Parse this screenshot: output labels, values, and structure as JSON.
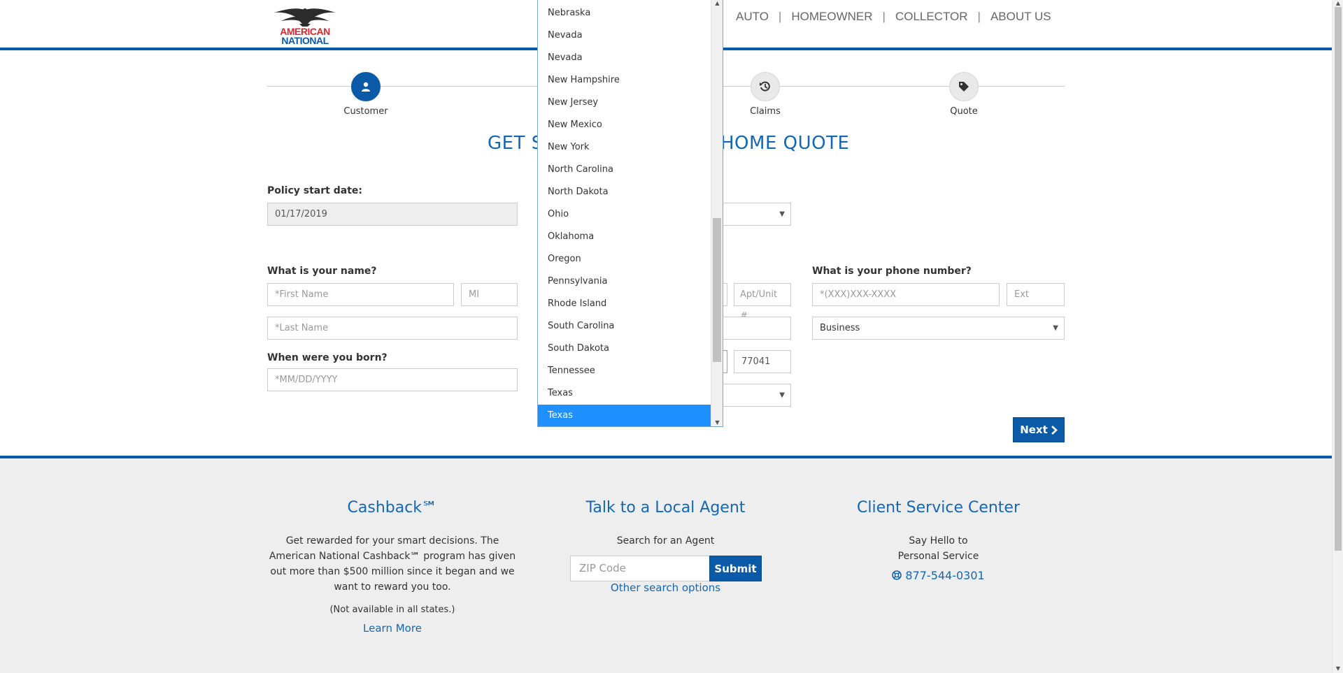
{
  "logo": {
    "line1": "AMERICAN",
    "line2": "NATIONAL"
  },
  "nav": {
    "items": [
      "AUTO",
      "HOMEOWNER",
      "COLLECTOR",
      "ABOUT US"
    ],
    "separator": "|"
  },
  "steps": [
    {
      "label": "Customer",
      "icon": "user-icon",
      "state": "active"
    },
    {
      "label": "Claims",
      "icon": "history-icon",
      "state": "inactive"
    },
    {
      "label": "Quote",
      "icon": "tag-icon",
      "state": "inactive"
    }
  ],
  "title": {
    "left": "GET S",
    "right": "HOME QUOTE"
  },
  "form": {
    "policy_start_label": "Policy start date:",
    "policy_start_value": "01/17/2019",
    "name_label": "What is your name?",
    "first_name_placeholder": "*First Name",
    "mi_placeholder": "MI",
    "last_name_placeholder": "*Last Name",
    "born_label": "When were you born?",
    "dob_placeholder": "*MM/DD/YYYY",
    "apt_placeholder": "Apt/Unit #",
    "zip_value": "77041",
    "phone_label": "What is your phone number?",
    "phone_placeholder": "*(XXX)XXX-XXXX",
    "ext_placeholder": "Ext",
    "phone_type": "Business",
    "next_label": "Next"
  },
  "state_dropdown": {
    "options": [
      "Nebraska",
      "Nevada",
      "Nevada",
      "New Hampshire",
      "New Jersey",
      "New Mexico",
      "New York",
      "North Carolina",
      "North Dakota",
      "Ohio",
      "Oklahoma",
      "Oregon",
      "Pennsylvania",
      "Rhode Island",
      "South Carolina",
      "South Dakota",
      "Tennessee",
      "Texas",
      "Texas"
    ],
    "selected_index": 18
  },
  "footer": {
    "cashback": {
      "title": "Cashback℠",
      "text": "Get rewarded for your smart decisions. The American National Cashback℠ program has given out more than $500 million since it began and we want to reward you too.",
      "note": "(Not available in all states.)",
      "link": "Learn More"
    },
    "agent": {
      "title": "Talk to a Local Agent",
      "subtitle": "Search for an Agent",
      "zip_placeholder": "ZIP Code",
      "submit": "Submit",
      "link": "Other search options"
    },
    "service": {
      "title": "Client Service Center",
      "line1": "Say Hello to",
      "line2": "Personal Service",
      "phone": "877-544-0301"
    }
  },
  "colors": {
    "brand_blue": "#0a5aa8",
    "brand_red": "#d9272e",
    "highlight": "#1e90ff",
    "footer_bg": "#eeeeee"
  }
}
